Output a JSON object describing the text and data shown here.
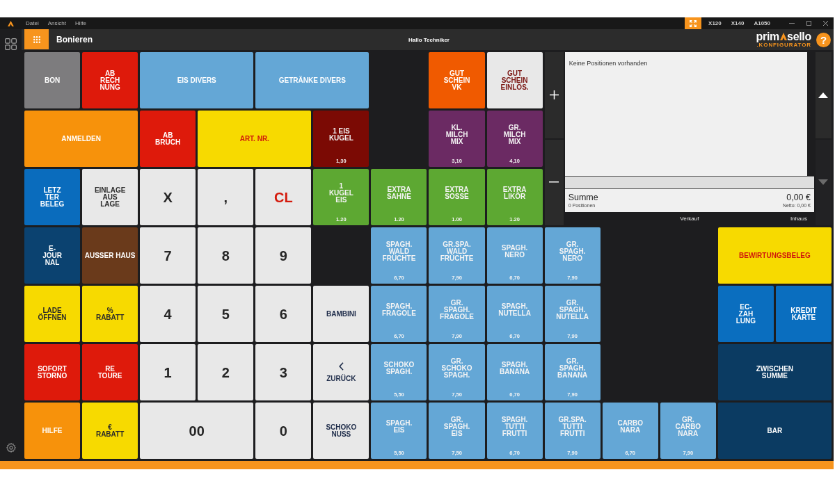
{
  "title_bar": {
    "menu": [
      "Datei",
      "Ansicht",
      "Hilfe"
    ],
    "devices": [
      "X120",
      "X140",
      "A1050"
    ]
  },
  "header": {
    "title": "Bonieren",
    "greeting": "Hallo Techniker",
    "logo": {
      "text_before": "prim",
      "text_after": "sello",
      "tagline": ".KONFIGURATOR"
    },
    "help": "?"
  },
  "tiles": [
    {
      "kind": "action",
      "label": "BON",
      "color": "#7d7c7e"
    },
    {
      "kind": "action",
      "label": "AB\nRECH\nNUNG",
      "color": "#de1a0b"
    },
    {
      "kind": "action",
      "label": "EIS DIVERS",
      "color": "#64a7d6"
    },
    {
      "kind": "action",
      "label": "GETRÄNKE DIVERS",
      "color": "#64a7d6"
    },
    {
      "kind": "action",
      "label": "GUT\nSCHEIN\nVK",
      "color": "#f05a00"
    },
    {
      "kind": "voucher",
      "label": "GUT\nSCHEIN\nEINLÖS.",
      "color": "#e8e8e8"
    },
    {
      "kind": "action",
      "label": "ANMELDEN",
      "color": "#f7920b"
    },
    {
      "kind": "action",
      "label": "AB\nBRUCH",
      "color": "#de1a0b"
    },
    {
      "kind": "alert",
      "label": "ART. NR.",
      "color": "#f7da00"
    },
    {
      "kind": "product",
      "label": "1 EIS\nKUGEL",
      "price": "1,30",
      "color": "#7b0a04"
    },
    {
      "kind": "product",
      "label": "KL.\nMILCH\nMIX",
      "price": "3,10",
      "color": "#6b2a63"
    },
    {
      "kind": "product",
      "label": "GR.\nMILCH\nMIX",
      "price": "4,10",
      "color": "#6b2a63"
    },
    {
      "kind": "action",
      "label": "LETZ\nTER\nBELEG",
      "color": "#0a6cbd"
    },
    {
      "kind": "option",
      "label": "EINLAGE\nAUS\nLAGE",
      "color": "#e8e8e8"
    },
    {
      "kind": "key",
      "label": "X",
      "color": "#e8e8e8"
    },
    {
      "kind": "key",
      "label": ",",
      "color": "#e8e8e8"
    },
    {
      "kind": "clear",
      "label": "CL",
      "color": "#e8e8e8"
    },
    {
      "kind": "product",
      "label": "1\nKUGEL\nEIS",
      "price": "1.20",
      "color": "#5da832"
    },
    {
      "kind": "product",
      "label": "EXTRA\nSAHNE",
      "price": "1.20",
      "color": "#5da832"
    },
    {
      "kind": "product",
      "label": "EXTRA\nSOSSE",
      "price": "1.00",
      "color": "#5da832"
    },
    {
      "kind": "product",
      "label": "EXTRA\nLIKÖR",
      "price": "1.20",
      "color": "#5da832"
    },
    {
      "kind": "action",
      "label": "E-\nJOUR\nNAL",
      "color": "#0b4270"
    },
    {
      "kind": "action",
      "label": "AUSSER HAUS",
      "color": "#6a3a1b"
    },
    {
      "kind": "key",
      "label": "7",
      "color": "#e8e8e8"
    },
    {
      "kind": "key",
      "label": "8",
      "color": "#e8e8e8"
    },
    {
      "kind": "key",
      "label": "9",
      "color": "#e8e8e8"
    },
    {
      "kind": "product",
      "label": "SPAGH.\nWALD\nFRÜCHTE",
      "price": "6,70",
      "color": "#64a7d6"
    },
    {
      "kind": "product",
      "label": "GR.SPA.\nWALD\nFRÜCHTE",
      "price": "7,90",
      "color": "#64a7d6"
    },
    {
      "kind": "product",
      "label": "SPAGH.\nNERO",
      "price": "6,70",
      "color": "#64a7d6"
    },
    {
      "kind": "product",
      "label": "GR.\nSPAGH.\nNERO",
      "price": "7,90",
      "color": "#64a7d6"
    },
    {
      "kind": "alert",
      "label": "BEWIRTUNGSBELEG",
      "color": "#f7da00"
    },
    {
      "kind": "option",
      "label": "LADE\nÖFFNEN",
      "color": "#f7da00"
    },
    {
      "kind": "option",
      "label": "%\nRABATT",
      "color": "#f7da00"
    },
    {
      "kind": "key",
      "label": "4",
      "color": "#e8e8e8"
    },
    {
      "kind": "key",
      "label": "5",
      "color": "#e8e8e8"
    },
    {
      "kind": "key",
      "label": "6",
      "color": "#e8e8e8"
    },
    {
      "kind": "plain",
      "label": "BAMBINI",
      "color": "#e8e8e8"
    },
    {
      "kind": "product",
      "label": "SPAGH.\nFRAGOLE",
      "price": "6,70",
      "color": "#64a7d6"
    },
    {
      "kind": "product",
      "label": "GR.\nSPAGH.\nFRAGOLE",
      "price": "7,90",
      "color": "#64a7d6"
    },
    {
      "kind": "product",
      "label": "SPAGH.\nNUTELLA",
      "price": "6,70",
      "color": "#64a7d6"
    },
    {
      "kind": "product",
      "label": "GR.\nSPAGH.\nNUTELLA",
      "price": "7,90",
      "color": "#64a7d6"
    },
    {
      "kind": "action",
      "label": "EC-\nZAH\nLUNG",
      "color": "#0a6ebf"
    },
    {
      "kind": "action",
      "label": "KREDIT\nKARTE",
      "color": "#0a6ebf"
    },
    {
      "kind": "action",
      "label": "SOFORT\nSTORNO",
      "color": "#de1a0b"
    },
    {
      "kind": "action",
      "label": "RE\nTOURE",
      "color": "#de1a0b"
    },
    {
      "kind": "key",
      "label": "1",
      "color": "#e8e8e8"
    },
    {
      "kind": "key",
      "label": "2",
      "color": "#e8e8e8"
    },
    {
      "kind": "key",
      "label": "3",
      "color": "#e8e8e8"
    },
    {
      "kind": "back",
      "label": "ZURÜCK",
      "color": "#e8e8e8"
    },
    {
      "kind": "product",
      "label": "SCHOKO\nSPAGH.",
      "price": "5,50",
      "color": "#64a7d6"
    },
    {
      "kind": "product",
      "label": "GR.\nSCHOKO\nSPAGH.",
      "price": "7,50",
      "color": "#64a7d6"
    },
    {
      "kind": "product",
      "label": "SPAGH.\nBANANA",
      "price": "6,70",
      "color": "#64a7d6"
    },
    {
      "kind": "product",
      "label": "GR.\nSPAGH.\nBANANA",
      "price": "7,90",
      "color": "#64a7d6"
    },
    {
      "kind": "action",
      "label": "ZWISCHEN\nSUMME",
      "color": "#0b3b62"
    },
    {
      "kind": "action",
      "label": "HILFE",
      "color": "#f7920b"
    },
    {
      "kind": "option",
      "label": "€\nRABATT",
      "color": "#f7da00"
    },
    {
      "kind": "key",
      "label": "00",
      "color": "#e8e8e8"
    },
    {
      "kind": "key",
      "label": "0",
      "color": "#e8e8e8"
    },
    {
      "kind": "plain",
      "label": "SCHOKO\nNUSS",
      "color": "#e8e8e8"
    },
    {
      "kind": "product",
      "label": "SPAGH.\nEIS",
      "price": "5,50",
      "color": "#64a7d6"
    },
    {
      "kind": "product",
      "label": "GR.\nSPAGH.\nEIS",
      "price": "7,50",
      "color": "#64a7d6"
    },
    {
      "kind": "product",
      "label": "SPAGH.\nTUTTI\nFRUTTI",
      "price": "6,70",
      "color": "#64a7d6"
    },
    {
      "kind": "product",
      "label": "GR.SPA.\nTUTTI\nFRUTTI",
      "price": "7,90",
      "color": "#64a7d6"
    },
    {
      "kind": "product",
      "label": "CARBO\nNARA",
      "price": "6,70",
      "color": "#64a7d6"
    },
    {
      "kind": "product",
      "label": "GR.\nCARBO\nNARA",
      "price": "7,90",
      "color": "#64a7d6"
    },
    {
      "kind": "action",
      "label": "BAR",
      "color": "#0b3b62"
    }
  ],
  "receipt": {
    "empty_message": "Keine Positionen vorhanden",
    "total_label": "Summe",
    "position_count": "0 Positionen",
    "total": "0,00 €",
    "net": "Netto: 0,00 €",
    "modes": [
      "Verkauf",
      "Inhaus"
    ],
    "scroll_buttons": [
      {
        "kind": "up",
        "disabled": false
      },
      {
        "kind": "down",
        "disabled": true
      }
    ]
  }
}
